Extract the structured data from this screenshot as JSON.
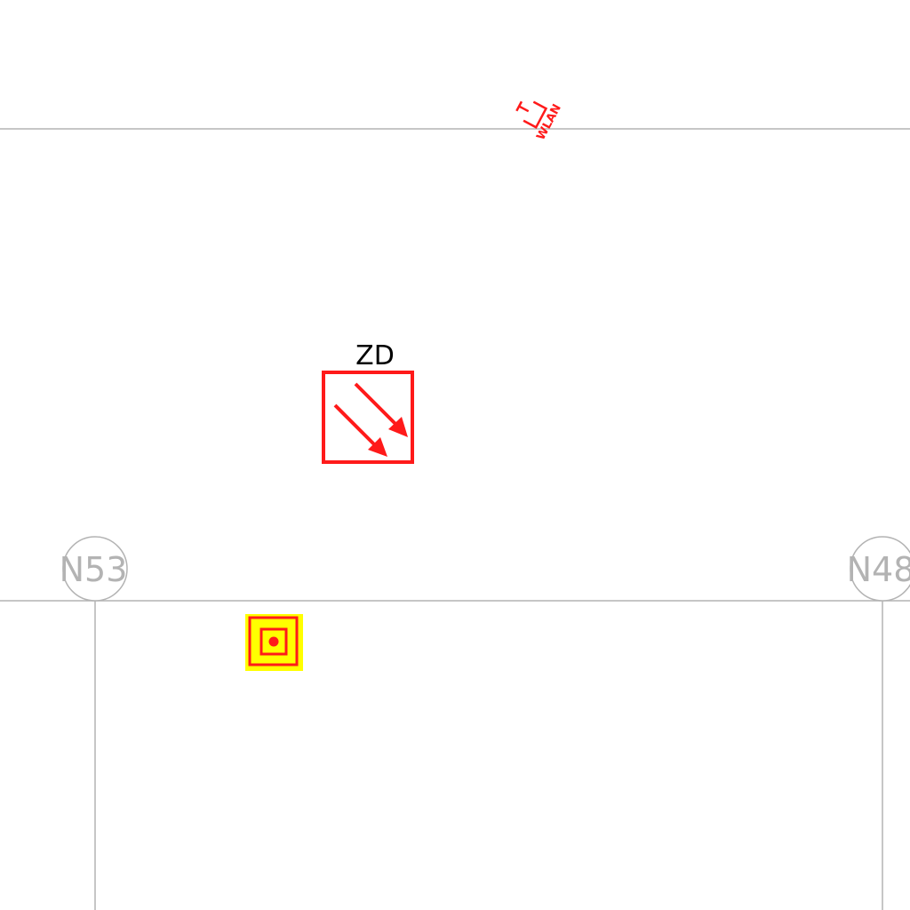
{
  "drawing": {
    "grid_color": "#b3b3b3",
    "symbol_color": "#ff1a1a",
    "highlight_color": "#ffff00",
    "label_color": "#000000",
    "grid_markers": [
      {
        "id": "N53"
      },
      {
        "id": "N48"
      }
    ],
    "symbols": {
      "zd": {
        "label": "ZD",
        "icon": "two-diagonal-arrows-icon"
      },
      "wlan": {
        "label": "WLAN",
        "icon": "wlan-access-point-icon"
      },
      "device": {
        "icon": "concentric-square-dot-icon"
      }
    }
  }
}
